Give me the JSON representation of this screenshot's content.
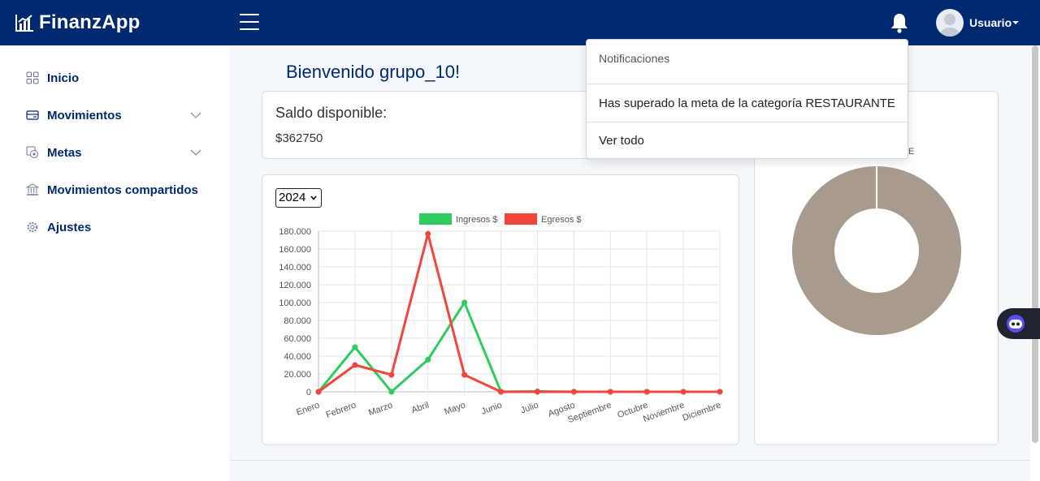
{
  "app": {
    "name": "FinanzApp"
  },
  "user": {
    "name": "Usuario"
  },
  "sidebar": {
    "items": [
      {
        "label": "Inicio",
        "icon": "grid-icon"
      },
      {
        "label": "Movimientos",
        "icon": "wallet-icon"
      },
      {
        "label": "Metas",
        "icon": "goal-icon"
      },
      {
        "label": "Movimientos compartidos",
        "icon": "bank-icon"
      },
      {
        "label": "Ajustes",
        "icon": "gear-icon"
      }
    ]
  },
  "main": {
    "welcome": "Bienvenido grupo_10!",
    "saldo": {
      "title": "Saldo disponible:",
      "value": "$362750"
    },
    "year": "2024"
  },
  "notifications": {
    "title": "Notificaciones",
    "message": "Has superado la meta de la categoría RESTAURANTE",
    "view_all": "Ver todo"
  },
  "donut": {
    "label_fragment": "ANTE",
    "color": "#a89a8d"
  },
  "colors": {
    "topbar": "#012970",
    "ingresos": "#2ecc5f",
    "egresos": "#f2453b"
  },
  "chart_data": {
    "type": "line",
    "categories": [
      "Enero",
      "Febrero",
      "Marzo",
      "Abril",
      "Mayo",
      "Junio",
      "Julio",
      "Agosto",
      "Septiembre",
      "Octubre",
      "Noviembre",
      "Diciembre"
    ],
    "series": [
      {
        "name": "Ingresos $",
        "color": "#2ecc5f",
        "values": [
          0,
          50000,
          0,
          36000,
          100000,
          0,
          500,
          0,
          0,
          0,
          0,
          0
        ]
      },
      {
        "name": "Egresos $",
        "color": "#f2453b",
        "values": [
          0,
          30000,
          19000,
          177000,
          19000,
          0,
          0,
          0,
          0,
          0,
          0,
          0
        ]
      }
    ],
    "ylim": [
      0,
      180000
    ],
    "yticks": [
      "0",
      "20.000",
      "40.000",
      "60.000",
      "80.000",
      "100.000",
      "120.000",
      "140.000",
      "160.000",
      "180.000"
    ],
    "grid": true,
    "legend": "top"
  }
}
